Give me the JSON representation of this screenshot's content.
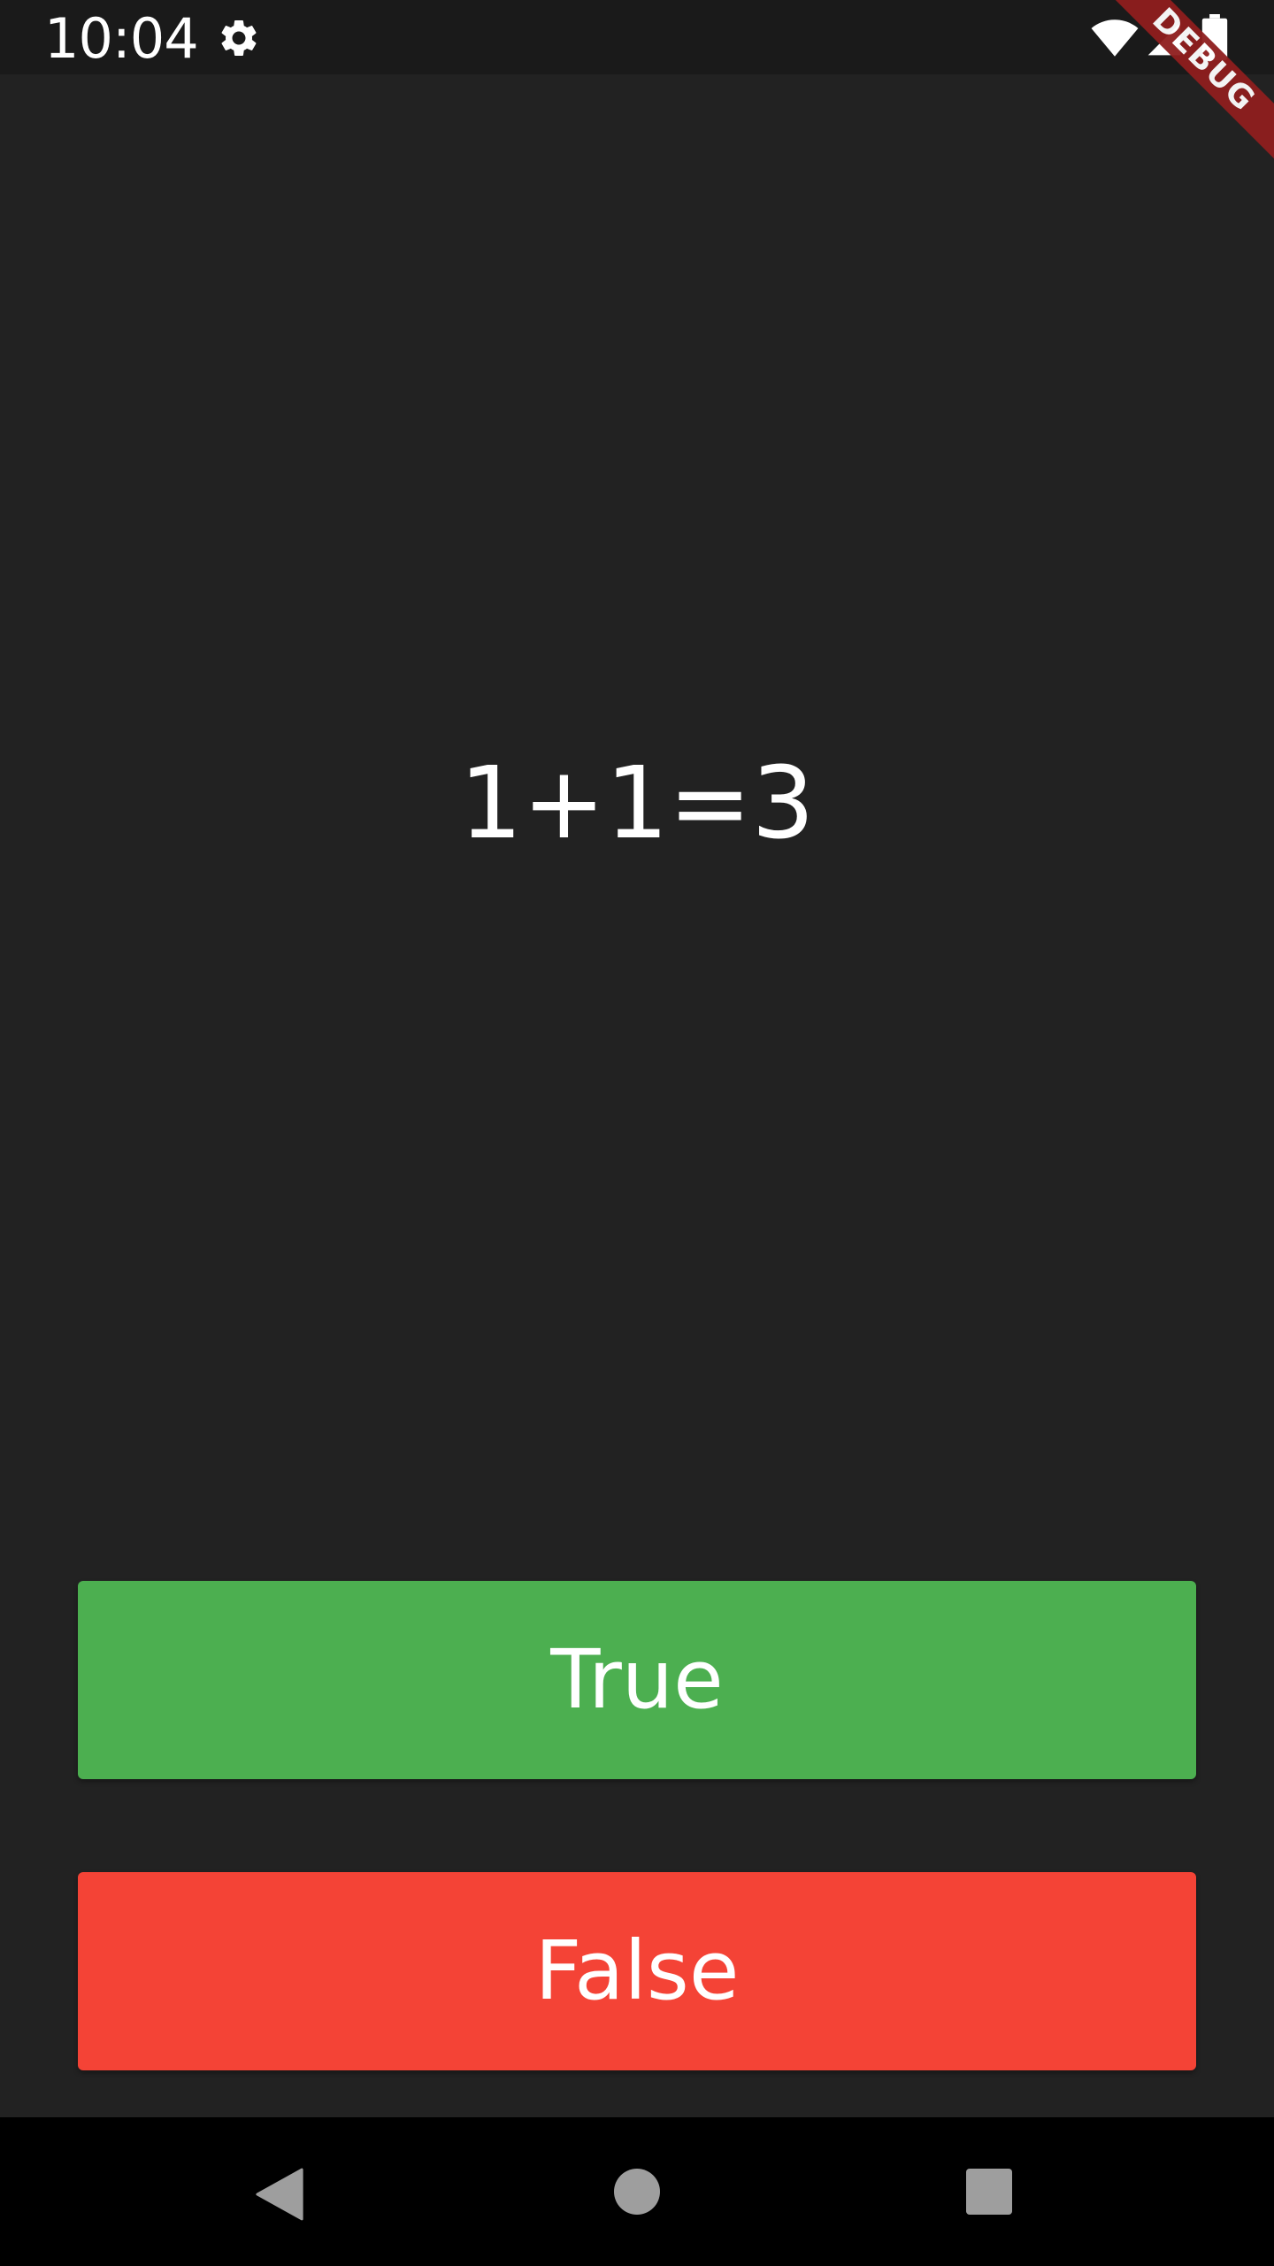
{
  "status_bar": {
    "time": "10:04",
    "icons": [
      "gear-icon",
      "wifi-icon",
      "cell-signal-icon",
      "battery-icon"
    ]
  },
  "debug_banner": {
    "label": "DEBUG",
    "color": "#8f1e1e"
  },
  "quiz": {
    "question": "1+1=3"
  },
  "answers": {
    "true_label": "True",
    "false_label": "False",
    "true_color": "#4caf50",
    "false_color": "#f44336"
  },
  "nav_bar": {
    "icons": [
      "back-icon",
      "home-icon",
      "recents-icon"
    ]
  },
  "colors": {
    "background": "#222222",
    "status_bar": "#1a1a1a",
    "nav_bar": "#000000"
  }
}
